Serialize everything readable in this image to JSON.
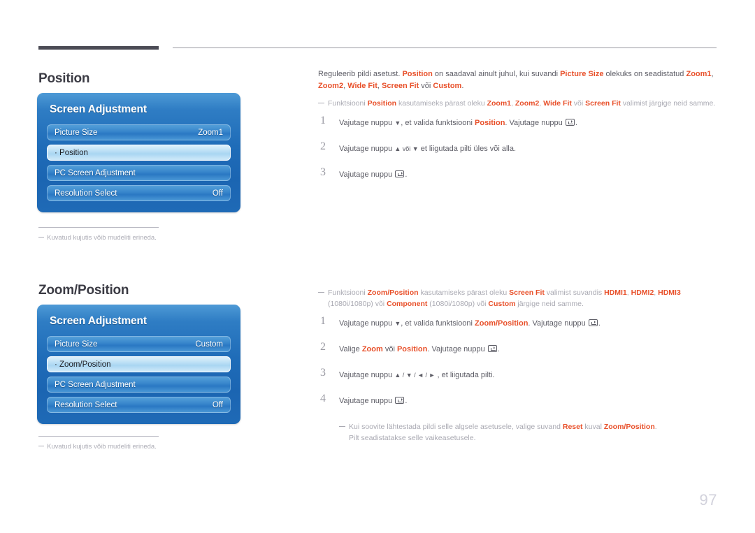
{
  "page": {
    "number": "97"
  },
  "sections": [
    {
      "heading": "Position",
      "osd": {
        "title": "Screen Adjustment",
        "rows": [
          {
            "label": "Picture Size",
            "value": "Zoom1",
            "selected": false
          },
          {
            "label": "· Position",
            "value": "",
            "selected": true
          },
          {
            "label": "PC Screen Adjustment",
            "value": "",
            "selected": false
          },
          {
            "label": "Resolution Select",
            "value": "Off",
            "selected": false
          }
        ]
      },
      "note": "Kuvatud kujutis võib mudeliti erineda.",
      "intro": {
        "t1": "Reguleerib pildi asetust. ",
        "b1": "Position",
        "t2": " on saadaval ainult juhul, kui suvandi ",
        "b2": "Picture Size",
        "t3": " olekuks on seadistatud ",
        "b3": "Zoom1",
        "t4": ", ",
        "b4": "Zoom2",
        "t5": ", ",
        "b5": "Wide Fit",
        "t6": ", ",
        "b6": "Screen Fit",
        "t7": " või ",
        "b7": "Custom",
        "t8": "."
      },
      "subnote": {
        "t1": "Funktsiooni ",
        "b1": "Position",
        "t2": " kasutamiseks pärast oleku ",
        "b2": "Zoom1",
        "t3": ", ",
        "b3": "Zoom2",
        "t4": ", ",
        "b4": "Wide Fit",
        "t5": " või ",
        "b5": "Screen Fit",
        "t6": " valimist järgige neid samme."
      },
      "steps": [
        {
          "num": "1",
          "t1": "Vajutage nuppu ",
          "arrow": "▼",
          "t2": ", et valida funktsiooni ",
          "b1": "Position",
          "t3": ". Vajutage nuppu ",
          "t4": "."
        },
        {
          "num": "2",
          "t1": "Vajutage nuppu ",
          "arrow": "▲ või ▼",
          "t2": " et liigutada pilti üles või alla.",
          "b1": "",
          "t3": "",
          "t4": ""
        },
        {
          "num": "3",
          "t1": "Vajutage nuppu ",
          "arrow": "",
          "t2": "",
          "b1": "",
          "t3": "",
          "t4": "."
        }
      ]
    },
    {
      "heading": "Zoom/Position",
      "osd": {
        "title": "Screen Adjustment",
        "rows": [
          {
            "label": "Picture Size",
            "value": "Custom",
            "selected": false
          },
          {
            "label": "· Zoom/Position",
            "value": "",
            "selected": true
          },
          {
            "label": "PC Screen Adjustment",
            "value": "",
            "selected": false
          },
          {
            "label": "Resolution Select",
            "value": "Off",
            "selected": false
          }
        ]
      },
      "note": "Kuvatud kujutis võib mudeliti erineda.",
      "subnote": {
        "t1": "Funktsiooni ",
        "b1": "Zoom/Position",
        "t2": " kasutamiseks pärast oleku ",
        "b2": "Screen Fit",
        "t3": " valimist suvandis ",
        "b3": "HDMI1",
        "t4": ", ",
        "b4": "HDMI2",
        "t5": ", ",
        "b5": "HDMI3",
        "t6": " (1080i/1080p) või ",
        "b6": "Component",
        "t7": " (1080i/1080p) või ",
        "b7": "Custom",
        "t8": " järgige neid samme."
      },
      "steps": [
        {
          "num": "1",
          "t1": "Vajutage nuppu ",
          "arrow": "▼",
          "t2": ", et valida funktsiooni ",
          "b1": "Zoom/Position",
          "t3": ". Vajutage nuppu ",
          "t4": "."
        },
        {
          "num": "2",
          "t1": "Valige ",
          "arrow": "",
          "t2": "",
          "b1": "Zoom",
          "t2b": " või ",
          "b2": "Position",
          "t3": ". Vajutage nuppu ",
          "t4": "."
        },
        {
          "num": "3",
          "t1": "Vajutage nuppu ",
          "arrow": "▲ / ▼ / ◄ / ►",
          "t2": " , et liigutada pilti.",
          "b1": "",
          "t3": "",
          "t4": ""
        },
        {
          "num": "4",
          "t1": "Vajutage nuppu ",
          "arrow": "",
          "t2": "",
          "b1": "",
          "t3": "",
          "t4": "."
        }
      ],
      "tailnote": {
        "t1": "Kui soovite lähtestada pildi selle algsele asetusele, valige suvand ",
        "b1": "Reset",
        "t2": " kuval ",
        "b2": "Zoom/Position",
        "t3": ".",
        "t4": "Pilt seadistatakse selle vaikeasetusele."
      }
    }
  ]
}
